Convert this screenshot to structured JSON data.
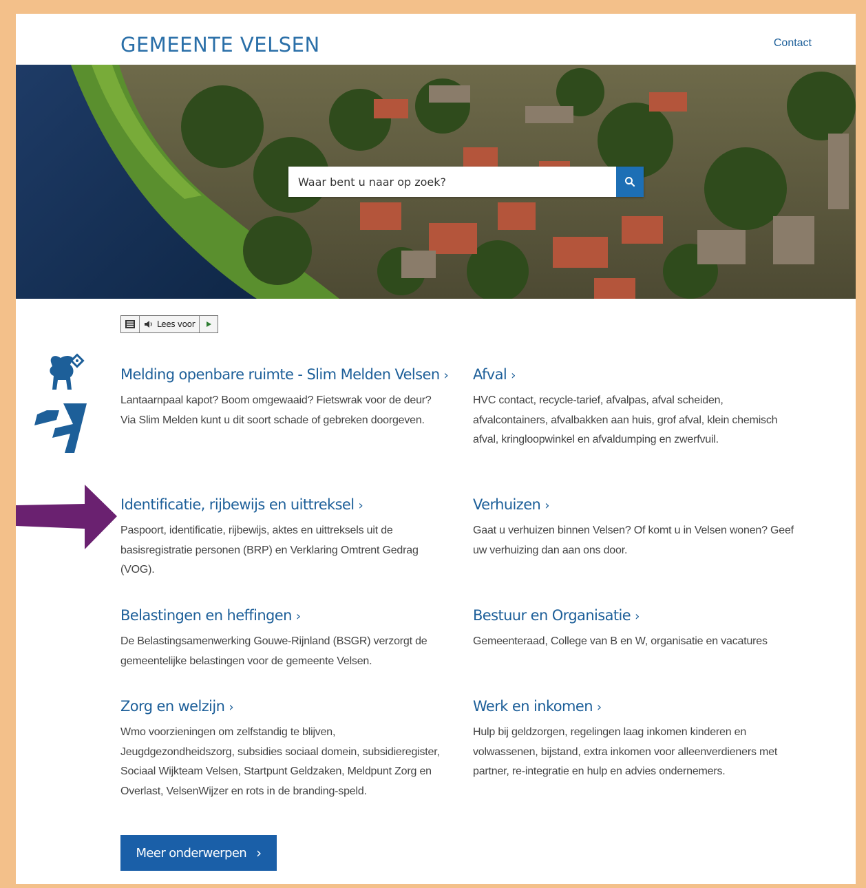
{
  "header": {
    "site_title": "GEMEENTE VELSEN",
    "contact_label": "Contact"
  },
  "search": {
    "placeholder": "Waar bent u naar op zoek?",
    "button_icon": "search-icon"
  },
  "readspeaker": {
    "menu_icon": "menu-icon",
    "speaker_icon": "speaker-icon",
    "label": "Lees voor",
    "play_icon": "play-icon"
  },
  "topics": [
    {
      "title": "Melding openbare ruimte - Slim Melden Velsen",
      "description": "Lantaarnpaal kapot? Boom omgewaaid? Fietswrak voor de deur? Via Slim Melden kunt u dit soort schade of gebreken doorgeven."
    },
    {
      "title": "Afval",
      "description": "HVC contact, recycle-tarief, afvalpas, afval scheiden, afvalcontainers, afvalbakken aan huis, grof afval, klein chemisch afval, kringloopwinkel en afvaldumping en zwerfvuil."
    },
    {
      "title": "Identificatie, rijbewijs en uittreksel",
      "description": "Paspoort, identificatie, rijbewijs, aktes en uittreksels uit de basisregistratie personen (BRP) en Verklaring Omtrent Gedrag (VOG)."
    },
    {
      "title": "Verhuizen",
      "description": "Gaat u verhuizen binnen Velsen? Of komt u in Velsen wonen? Geef uw verhuizing dan aan ons door."
    },
    {
      "title": "Belastingen en heffingen",
      "description": "De Belastingsamenwerking Gouwe-Rijnland (BSGR) verzorgt de gemeentelijke belastingen voor de gemeente Velsen."
    },
    {
      "title": "Bestuur en Organisatie",
      "description": "Gemeenteraad, College van B en W, organisatie en vacatures"
    },
    {
      "title": "Zorg en welzijn",
      "description": "Wmo voorzieningen om zelfstandig te blijven, Jeugdgezondheidszorg, subsidies sociaal domein, subsidieregister, Sociaal Wijkteam Velsen, Startpunt Geldzaken, Meldpunt Zorg en Overlast, VelsenWijzer en rots in de branding-speld."
    },
    {
      "title": "Werk en inkomen",
      "description": "Hulp bij geldzorgen, regelingen laag inkomen kinderen en volwassenen, bijstand, extra inkomen voor alleenverdieners met partner, re-integratie en hulp en advies ondernemers."
    }
  ],
  "chevron": "›",
  "more_button": "Meer onderwerpen",
  "colors": {
    "frame": "#f3c08a",
    "link_blue": "#1d5f99",
    "button_blue": "#1a5fa8",
    "arrow_purple": "#6a2170"
  }
}
